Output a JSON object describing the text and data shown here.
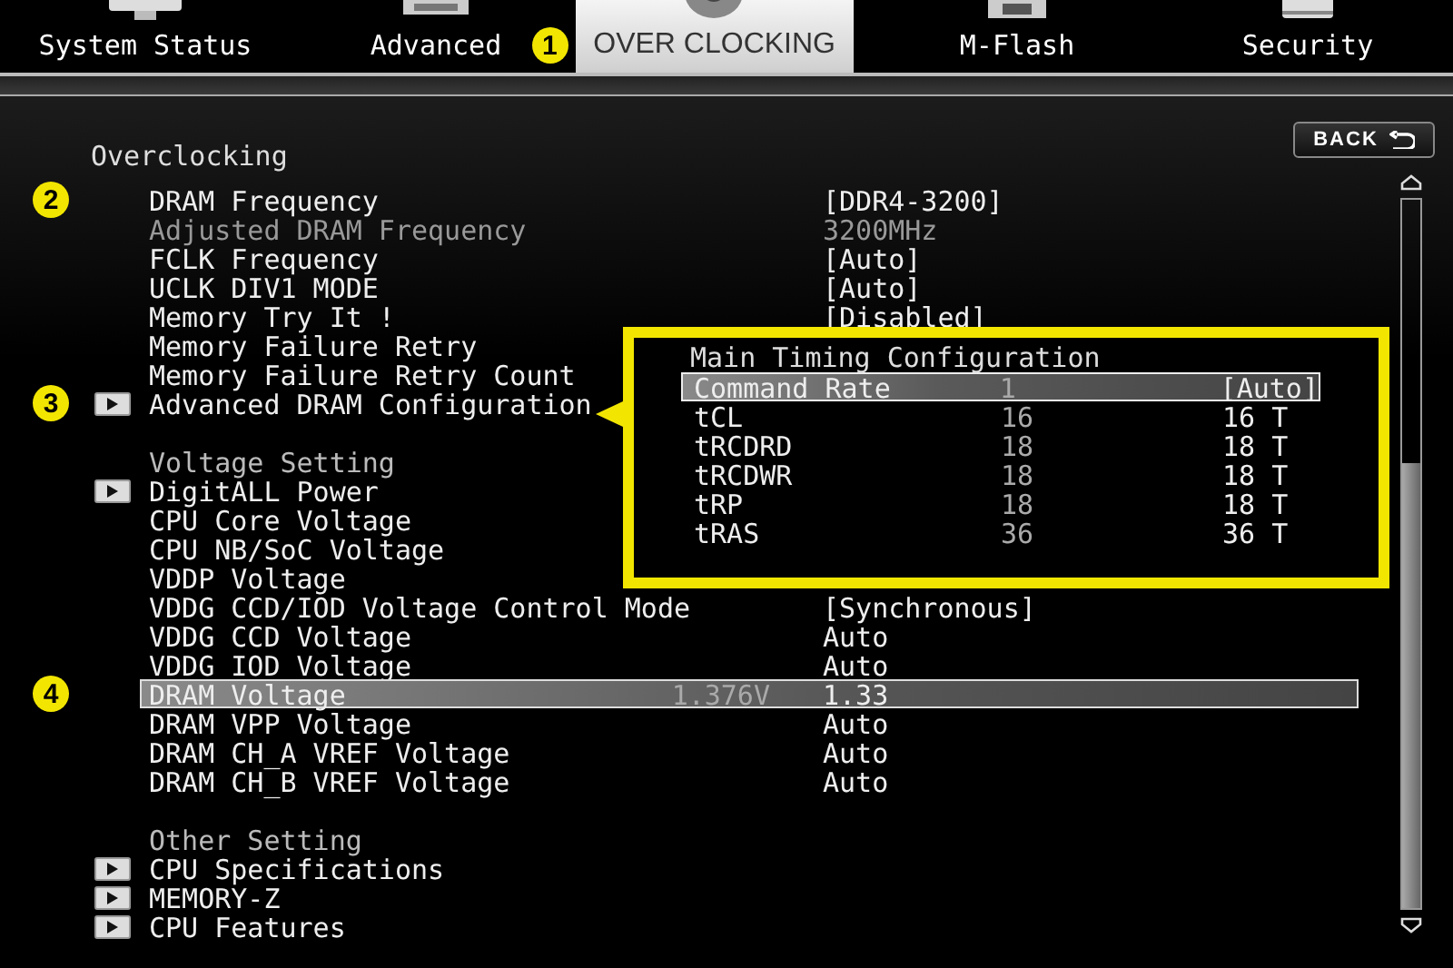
{
  "tabs": [
    {
      "label": "System Status",
      "selected": false
    },
    {
      "label": "Advanced",
      "selected": false
    },
    {
      "label": "OVER CLOCKING",
      "selected": true,
      "marker": "1"
    },
    {
      "label": "M-Flash",
      "selected": false
    },
    {
      "label": "Security",
      "selected": false
    }
  ],
  "back_button": {
    "label": "BACK"
  },
  "section_title": "Overclocking",
  "rows": [
    {
      "kind": "setting",
      "label": "DRAM Frequency",
      "value": "[DDR4-3200]",
      "marker": "2",
      "disabled": false,
      "selected": false
    },
    {
      "kind": "setting",
      "label": "Adjusted DRAM Frequency",
      "value": "3200MHz",
      "disabled": true,
      "selected": false
    },
    {
      "kind": "setting",
      "label": "FCLK Frequency",
      "value": "[Auto]",
      "disabled": false,
      "selected": false
    },
    {
      "kind": "setting",
      "label": "UCLK DIV1 MODE",
      "value": "[Auto]",
      "disabled": false,
      "selected": false
    },
    {
      "kind": "setting",
      "label": "Memory Try It !",
      "value": "[Disabled]",
      "disabled": false,
      "selected": false
    },
    {
      "kind": "setting",
      "label": "Memory Failure Retry",
      "disabled": false,
      "selected": false
    },
    {
      "kind": "setting",
      "label": "Memory Failure Retry Count",
      "disabled": false,
      "selected": false
    },
    {
      "kind": "submenu",
      "label": "Advanced DRAM Configuration",
      "marker": "3",
      "selected": false
    },
    {
      "kind": "header",
      "label": "Voltage Setting"
    },
    {
      "kind": "submenu",
      "label": "DigitALL Power",
      "selected": false
    },
    {
      "kind": "setting",
      "label": "CPU Core Voltage",
      "disabled": false,
      "selected": false
    },
    {
      "kind": "setting",
      "label": "CPU NB/SoC Voltage",
      "disabled": false,
      "selected": false
    },
    {
      "kind": "setting",
      "label": "VDDP Voltage",
      "disabled": false,
      "selected": false
    },
    {
      "kind": "setting",
      "label": "VDDG CCD/IOD Voltage Control Mode",
      "value": "[Synchronous]",
      "disabled": false,
      "selected": false
    },
    {
      "kind": "setting",
      "label": "VDDG CCD Voltage",
      "value": "Auto",
      "disabled": false,
      "selected": false
    },
    {
      "kind": "setting",
      "label": "VDDG IOD Voltage",
      "value": "Auto",
      "disabled": false,
      "selected": false
    },
    {
      "kind": "setting",
      "label": "DRAM Voltage",
      "reading": "1.376V",
      "value": "1.33",
      "marker": "4",
      "disabled": false,
      "selected": true
    },
    {
      "kind": "setting",
      "label": "DRAM VPP Voltage",
      "value": "Auto",
      "disabled": false,
      "selected": false
    },
    {
      "kind": "setting",
      "label": "DRAM CH_A VREF Voltage",
      "value": "Auto",
      "disabled": false,
      "selected": false
    },
    {
      "kind": "setting",
      "label": "DRAM CH_B VREF Voltage",
      "value": "Auto",
      "disabled": false,
      "selected": false
    },
    {
      "kind": "header",
      "label": "Other Setting"
    },
    {
      "kind": "submenu",
      "label": "CPU Specifications",
      "selected": false
    },
    {
      "kind": "submenu",
      "label": "MEMORY-Z",
      "selected": false
    },
    {
      "kind": "submenu",
      "label": "CPU Features",
      "selected": false
    }
  ],
  "popup": {
    "title": "Main Timing Configuration",
    "rows": [
      {
        "name": "Command Rate",
        "current": "1",
        "setting": "[Auto]",
        "selected": true
      },
      {
        "name": "tCL",
        "current": "16",
        "setting": "16 T",
        "selected": false
      },
      {
        "name": "tRCDRD",
        "current": "18",
        "setting": "18 T",
        "selected": false
      },
      {
        "name": "tRCDWR",
        "current": "18",
        "setting": "18 T",
        "selected": false
      },
      {
        "name": "tRP",
        "current": "18",
        "setting": "18 T",
        "selected": false
      },
      {
        "name": "tRAS",
        "current": "36",
        "setting": "36 T",
        "selected": false
      }
    ]
  }
}
